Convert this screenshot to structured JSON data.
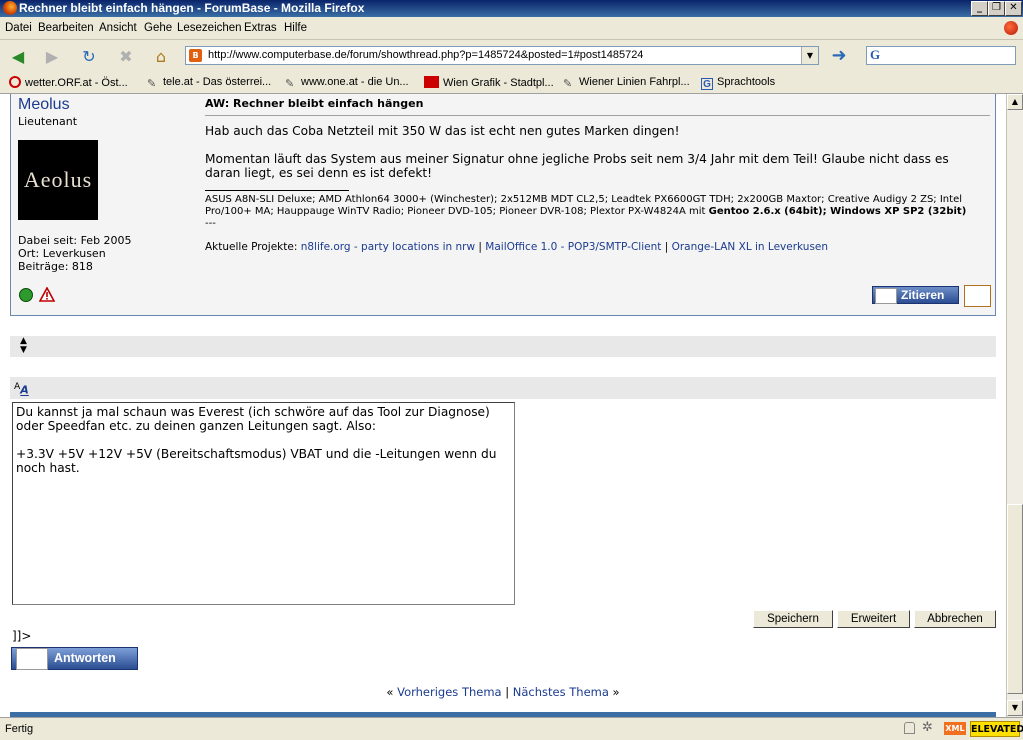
{
  "window": {
    "title": "Rechner bleibt einfach hängen - ForumBase - Mozilla Firefox"
  },
  "menu": [
    "Datei",
    "Bearbeiten",
    "Ansicht",
    "Gehe",
    "Lesezeichen",
    "Extras",
    "Hilfe"
  ],
  "address": {
    "url": "http://www.computerbase.de/forum/showthread.php?p=1485724&posted=1#post1485724"
  },
  "bookmarks": [
    {
      "label": "wetter.ORF.at - Öst...",
      "icon": "orf-icon"
    },
    {
      "label": "tele.at - Das österrei...",
      "icon": "bookmark-icon"
    },
    {
      "label": "www.one.at - die Un...",
      "icon": "bookmark-icon"
    },
    {
      "label": "Wien Grafik - Stadtpl...",
      "icon": "map-icon"
    },
    {
      "label": "Wiener Linien Fahrpl...",
      "icon": "bookmark-icon"
    },
    {
      "label": "Sprachtools",
      "icon": "google-icon"
    }
  ],
  "post": {
    "user": {
      "name": "Meolus",
      "rank": "Lieutenant",
      "avatar_text": "Aeolus",
      "joined": "Dabei seit: Feb 2005",
      "location": "Ort: Leverkusen",
      "posts": "Beiträge: 818"
    },
    "title": "AW: Rechner bleibt einfach hängen",
    "paragraph1": "Hab auch das Coba Netzteil mit 350 W das ist echt nen gutes Marken dingen!",
    "paragraph2": "Momentan läuft das System aus meiner Signatur ohne jegliche Probs seit nem 3/4 Jahr mit dem Teil! Glaube nicht dass es daran liegt, es sei denn es ist defekt!",
    "signature": "ASUS A8N-SLI Deluxe; AMD Athlon64 3000+ (Winchester); 2x512MB MDT CL2,5; Leadtek PX6600GT TDH; 2x200GB Maxtor; Creative Audigy 2 ZS; Intel Pro/100+ MA; Hauppauge WinTV Radio; Pioneer DVD-105; Pioneer DVR-108; Plextor PX-W4824A mit ",
    "signature_bold": "Gentoo 2.6.x (64bit); Windows XP SP2 (32bit)",
    "sig_sep": "---",
    "projects_label": "Aktuelle Projekte: ",
    "projects": [
      "n8life.org - party locations in nrw",
      "MailOffice 1.0 - POP3/SMTP-Client",
      "Orange-LAN XL in Leverkusen"
    ],
    "project_sep": " | ",
    "quote_label": "Zitieren"
  },
  "editor": {
    "font_small": "A",
    "font_big": "A",
    "text": "Du kannst ja mal schaun was Everest (ich schwöre auf das Tool zur Diagnose)\noder Speedfan etc. zu deinen ganzen Leitungen sagt. Also:\n\n+3.3V +5V +12V +5V (Bereitschaftsmodus) VBAT und die -Leitungen wenn du\nnoch hast.",
    "save": "Speichern",
    "advanced": "Erweitert",
    "cancel": "Abbrechen"
  },
  "stray_text": "]]>",
  "reply_label": "Antworten",
  "thread_nav": {
    "prev_marker": "«",
    "prev": "Vorheriges Thema",
    "sep": " | ",
    "next": "Nächstes Thema",
    "next_marker": "»"
  },
  "status": {
    "text": "Fertig",
    "xml": "XML",
    "elevated": "ELEVATED"
  }
}
